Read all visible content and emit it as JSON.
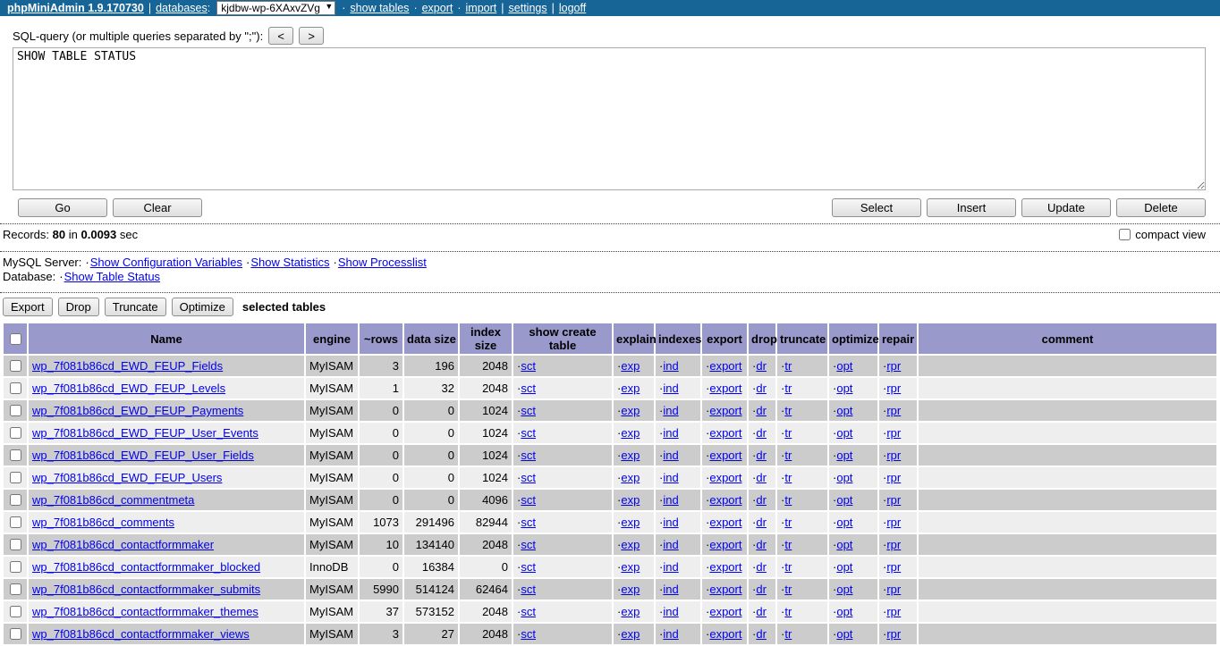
{
  "topbar": {
    "title": "phpMiniAdmin 1.9.170730",
    "sep_pipe": "|",
    "sep_dot": "·",
    "databases_label": "databases",
    "colon": ":",
    "db_select_value": "kjdbw-wp-6XAxvZVg",
    "arrow": "▼",
    "links": [
      "show tables",
      "export",
      "import",
      "settings",
      "logoff"
    ]
  },
  "query": {
    "label": "SQL-query (or multiple queries separated by \";\"):",
    "prev_label": "<",
    "next_label": ">",
    "value": "SHOW TABLE STATUS",
    "go_label": "Go",
    "clear_label": "Clear",
    "select_label": "Select",
    "insert_label": "Insert",
    "update_label": "Update",
    "delete_label": "Delete"
  },
  "status": {
    "records_label": "Records:",
    "records_count": "80",
    "in_label": "in",
    "duration": "0.0093",
    "sec_label": "sec",
    "compact_view_label": "compact view"
  },
  "server": {
    "mysql_label": "MySQL Server:",
    "dot": "·",
    "mysql_links": [
      "Show Configuration Variables",
      "Show Statistics",
      "Show Processlist"
    ],
    "database_label": "Database:",
    "database_links": [
      "Show Table Status"
    ]
  },
  "table_actions": {
    "buttons": [
      "Export",
      "Drop",
      "Truncate",
      "Optimize"
    ],
    "suffix": "selected tables"
  },
  "table": {
    "headers": [
      "Name",
      "engine",
      "~rows",
      "data size",
      "index size",
      "show create table",
      "explain",
      "indexes",
      "export",
      "drop",
      "truncate",
      "optimize",
      "repair",
      "comment"
    ],
    "action_dot": "·",
    "action_labels": [
      "sct",
      "exp",
      "ind",
      "export",
      "dr",
      "tr",
      "opt",
      "rpr"
    ],
    "rows": [
      {
        "name": "wp_7f081b86cd_EWD_FEUP_Fields",
        "engine": "MyISAM",
        "rows": "3",
        "data_size": "196",
        "index_size": "2048",
        "comment": ""
      },
      {
        "name": "wp_7f081b86cd_EWD_FEUP_Levels",
        "engine": "MyISAM",
        "rows": "1",
        "data_size": "32",
        "index_size": "2048",
        "comment": ""
      },
      {
        "name": "wp_7f081b86cd_EWD_FEUP_Payments",
        "engine": "MyISAM",
        "rows": "0",
        "data_size": "0",
        "index_size": "1024",
        "comment": ""
      },
      {
        "name": "wp_7f081b86cd_EWD_FEUP_User_Events",
        "engine": "MyISAM",
        "rows": "0",
        "data_size": "0",
        "index_size": "1024",
        "comment": ""
      },
      {
        "name": "wp_7f081b86cd_EWD_FEUP_User_Fields",
        "engine": "MyISAM",
        "rows": "0",
        "data_size": "0",
        "index_size": "1024",
        "comment": ""
      },
      {
        "name": "wp_7f081b86cd_EWD_FEUP_Users",
        "engine": "MyISAM",
        "rows": "0",
        "data_size": "0",
        "index_size": "1024",
        "comment": ""
      },
      {
        "name": "wp_7f081b86cd_commentmeta",
        "engine": "MyISAM",
        "rows": "0",
        "data_size": "0",
        "index_size": "4096",
        "comment": ""
      },
      {
        "name": "wp_7f081b86cd_comments",
        "engine": "MyISAM",
        "rows": "1073",
        "data_size": "291496",
        "index_size": "82944",
        "comment": ""
      },
      {
        "name": "wp_7f081b86cd_contactformmaker",
        "engine": "MyISAM",
        "rows": "10",
        "data_size": "134140",
        "index_size": "2048",
        "comment": ""
      },
      {
        "name": "wp_7f081b86cd_contactformmaker_blocked",
        "engine": "InnoDB",
        "rows": "0",
        "data_size": "16384",
        "index_size": "0",
        "comment": ""
      },
      {
        "name": "wp_7f081b86cd_contactformmaker_submits",
        "engine": "MyISAM",
        "rows": "5990",
        "data_size": "514124",
        "index_size": "62464",
        "comment": ""
      },
      {
        "name": "wp_7f081b86cd_contactformmaker_themes",
        "engine": "MyISAM",
        "rows": "37",
        "data_size": "573152",
        "index_size": "2048",
        "comment": ""
      },
      {
        "name": "wp_7f081b86cd_contactformmaker_views",
        "engine": "MyISAM",
        "rows": "3",
        "data_size": "27",
        "index_size": "2048",
        "comment": ""
      }
    ]
  },
  "colors": {
    "topbar_bg": "#176496",
    "header_bg": "#9999CC",
    "row_odd_bg": "#CCCCCC",
    "row_even_bg": "#EEEEEE",
    "link_blue": "#0000EE"
  }
}
